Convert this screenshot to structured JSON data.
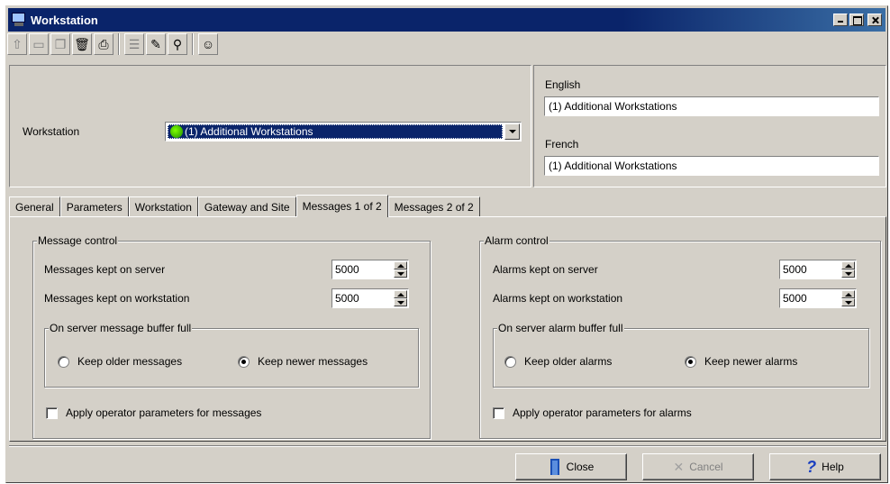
{
  "window": {
    "title": "Workstation"
  },
  "toolbar": {
    "buttons": [
      {
        "icon": "new-icon",
        "glyph": "⇧"
      },
      {
        "icon": "save-icon",
        "glyph": "▭"
      },
      {
        "icon": "copy-icon",
        "glyph": "❐"
      },
      {
        "icon": "delete-icon",
        "glyph": "🗑"
      },
      {
        "icon": "print-icon",
        "glyph": "⎙"
      },
      {
        "icon": "list-icon",
        "glyph": "☰"
      },
      {
        "icon": "link-icon",
        "glyph": "✎"
      },
      {
        "icon": "find-icon",
        "glyph": "⚲"
      },
      {
        "icon": "user-icon",
        "glyph": "☺"
      }
    ]
  },
  "header": {
    "workstation_label": "Workstation",
    "workstation_value": "(1) Additional Workstations",
    "english_label": "English",
    "english_value": "(1) Additional Workstations",
    "french_label": "French",
    "french_value": "(1) Additional Workstations"
  },
  "tabs": [
    {
      "label": "General"
    },
    {
      "label": "Parameters"
    },
    {
      "label": "Workstation"
    },
    {
      "label": "Gateway and Site"
    },
    {
      "label": "Messages 1 of 2"
    },
    {
      "label": "Messages 2 of 2"
    }
  ],
  "message_control": {
    "title": "Message control",
    "kept_on_server_label": "Messages kept on server",
    "kept_on_server_value": "5000",
    "kept_on_workstation_label": "Messages kept on workstation",
    "kept_on_workstation_value": "5000",
    "buffer_title": "On server message buffer full",
    "keep_older_label": "Keep older messages",
    "keep_newer_label": "Keep newer messages",
    "apply_label": "Apply operator parameters for messages"
  },
  "alarm_control": {
    "title": "Alarm control",
    "kept_on_server_label": "Alarms kept on server",
    "kept_on_server_value": "5000",
    "kept_on_workstation_label": "Alarms kept on workstation",
    "kept_on_workstation_value": "5000",
    "buffer_title": "On server alarm buffer full",
    "keep_older_label": "Keep older alarms",
    "keep_newer_label": "Keep newer alarms",
    "apply_label": "Apply operator parameters for alarms"
  },
  "buttons": {
    "close_label": "Close",
    "cancel_label": "Cancel",
    "help_label": "Help"
  }
}
